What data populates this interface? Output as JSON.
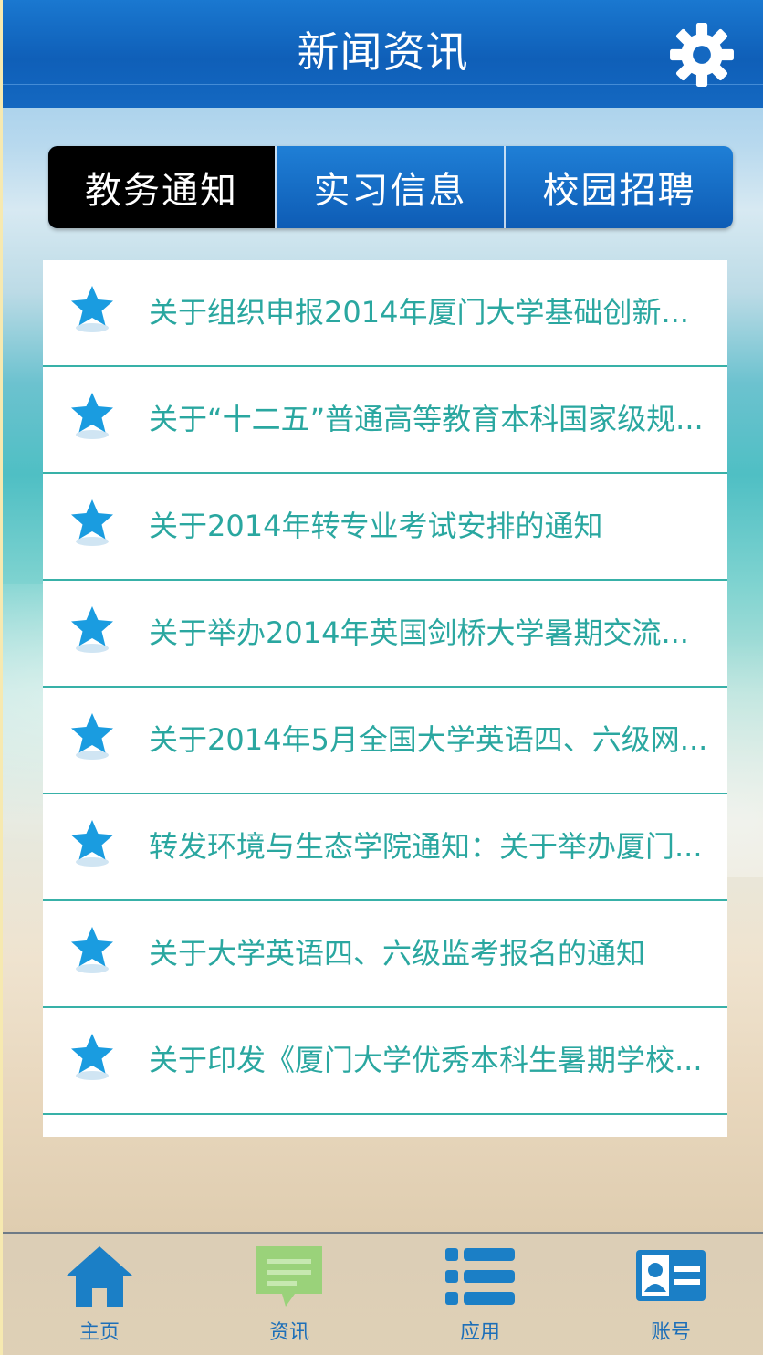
{
  "header": {
    "title": "新闻资讯",
    "settings_icon": "gear-icon"
  },
  "tabs": [
    {
      "label": "教务通知",
      "active": true
    },
    {
      "label": "实习信息",
      "active": false
    },
    {
      "label": "校园招聘",
      "active": false
    }
  ],
  "news": [
    {
      "title": "关于组织申报2014年厦门大学基础创新...",
      "icon": "star-icon"
    },
    {
      "title": "关于“十二五”普通高等教育本科国家级规...",
      "icon": "star-icon"
    },
    {
      "title": "关于2014年转专业考试安排的通知",
      "icon": "star-icon"
    },
    {
      "title": "关于举办2014年英国剑桥大学暑期交流...",
      "icon": "star-icon"
    },
    {
      "title": "关于2014年5月全国大学英语四、六级网...",
      "icon": "star-icon"
    },
    {
      "title": "转发环境与生态学院通知：关于举办厦门...",
      "icon": "star-icon"
    },
    {
      "title": "关于大学英语四、六级监考报名的通知",
      "icon": "star-icon"
    },
    {
      "title": "关于印发《厦门大学优秀本科生暑期学校...",
      "icon": "star-icon"
    }
  ],
  "bottom_nav": [
    {
      "label": "主页",
      "icon": "home-icon"
    },
    {
      "label": "资讯",
      "icon": "news-icon",
      "active": true
    },
    {
      "label": "应用",
      "icon": "list-icon"
    },
    {
      "label": "账号",
      "icon": "account-card-icon"
    }
  ],
  "colors": {
    "header_blue": "#1468c1",
    "tab_active": "#000000",
    "item_text": "#2aa7a0",
    "star_blue": "#1a9ce0",
    "nav_active_green": "#9ad27a"
  }
}
